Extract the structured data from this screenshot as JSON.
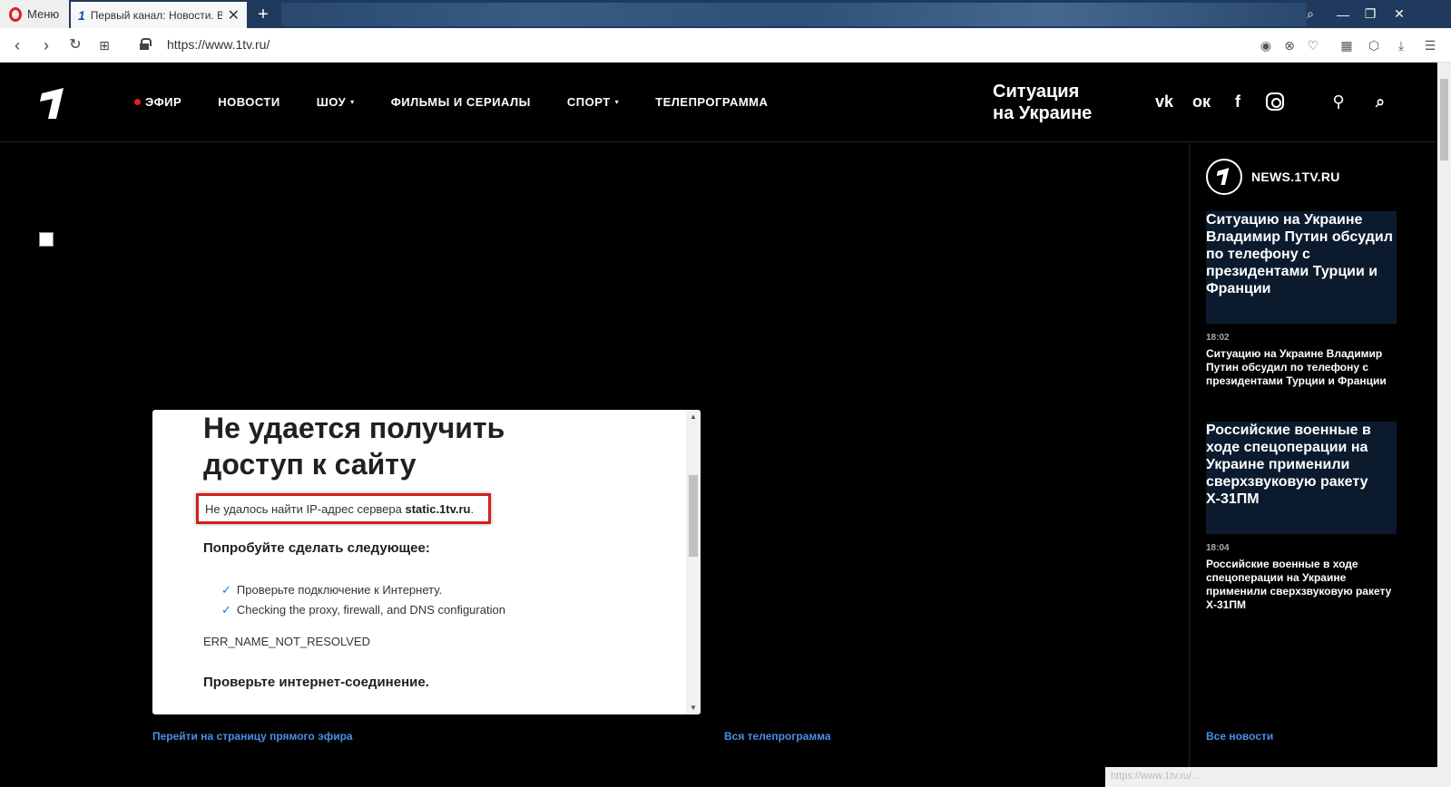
{
  "browser": {
    "menu_label": "Меню",
    "tab_title": "Первый канал: Новости. В",
    "tab_icon": "1",
    "url": "https://www.1tv.ru/",
    "new_tab": "+"
  },
  "header": {
    "menu": [
      {
        "label": "ЭФИР"
      },
      {
        "label": "НОВОСТИ"
      },
      {
        "label": "ШОУ"
      },
      {
        "label": "ФИЛЬМЫ И СЕРИАЛЫ"
      },
      {
        "label": "СПОРТ"
      },
      {
        "label": "ТЕЛЕПРОГРАММА"
      }
    ],
    "situation_line1": "Ситуация",
    "situation_line2": "на Украине",
    "social": {
      "vk": "vk",
      "ok": "ок",
      "fb": "f"
    }
  },
  "error": {
    "title": "Не удается получить доступ к сайту",
    "message_prefix": "Не удалось найти IP-адрес сервера ",
    "message_host": "static.1tv.ru",
    "message_suffix": ".",
    "try_heading": "Попробуйте сделать следующее:",
    "suggestions": [
      "Проверьте подключение к Интернету.",
      "Checking the proxy, firewall, and DNS configuration"
    ],
    "code": "ERR_NAME_NOT_RESOLVED",
    "check_heading": "Проверьте интернет-соединение."
  },
  "links": {
    "live": "Перейти на страницу прямого эфира",
    "schedule": "Вся телепрограмма"
  },
  "sidebar": {
    "brand": "NEWS.1TV.RU",
    "items": [
      {
        "image_alt": "Ситуацию на Украине Владимир Путин обсудил по телефону с президентами Турции и Франции",
        "time": "18:02",
        "title": "Ситуацию на Украине Владимир Путин обсудил по телефону с президентами Турции и Франции"
      },
      {
        "image_alt": "Российские военные в ходе спецоперации на Украине применили сверхзвуковую ракету Х-31ПМ",
        "time": "18:04",
        "title": "Российские военные в ходе спецоперации на Украине применили сверхзвуковую ракету Х-31ПМ"
      }
    ],
    "all_news": "Все новости"
  },
  "status_url": "https://www.1tv.ru/..."
}
